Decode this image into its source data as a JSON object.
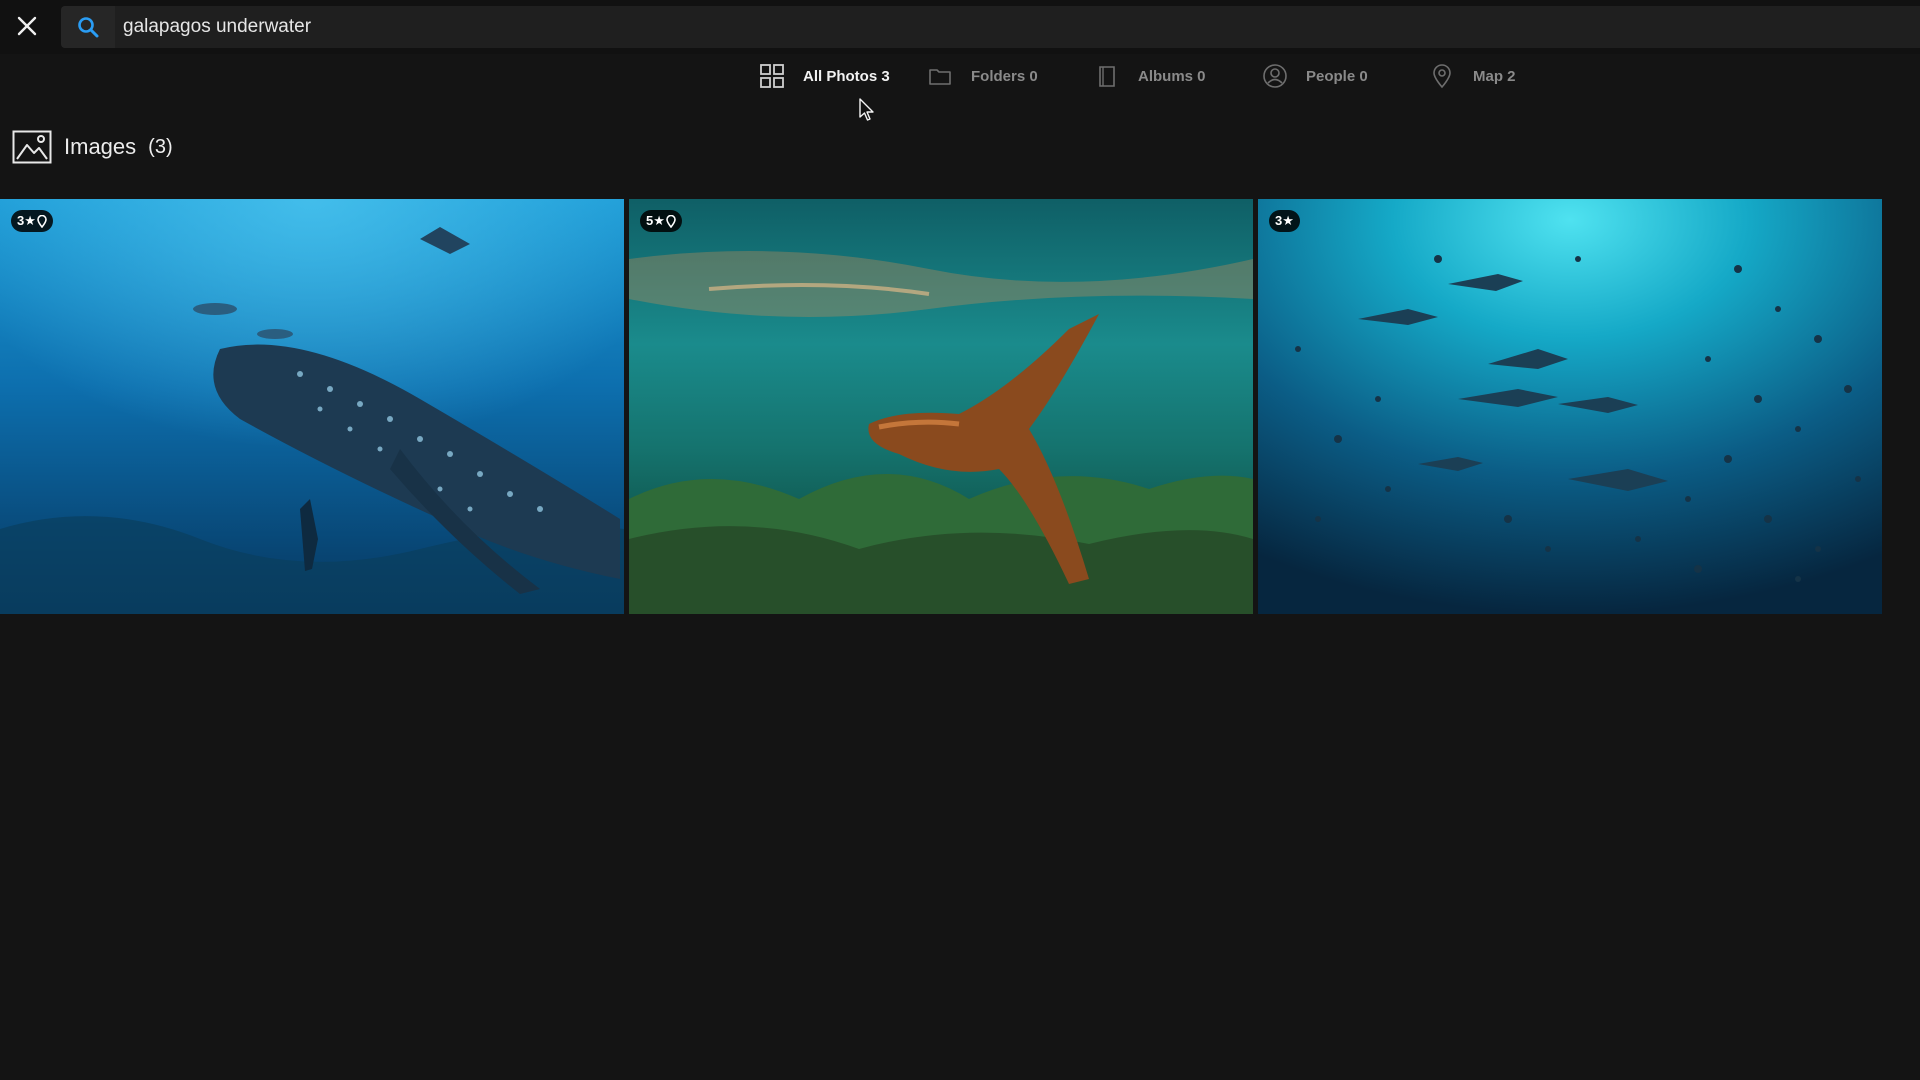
{
  "search": {
    "value": "galapagos underwater",
    "placeholder": "Search"
  },
  "tabs": [
    {
      "label": "All Photos 3",
      "icon": "grid-icon",
      "active": true
    },
    {
      "label": "Folders 0",
      "icon": "folder-icon",
      "active": false
    },
    {
      "label": "Albums 0",
      "icon": "album-icon",
      "active": false
    },
    {
      "label": "People 0",
      "icon": "person-icon",
      "active": false
    },
    {
      "label": "Map 2",
      "icon": "map-pin-icon",
      "active": false
    }
  ],
  "section": {
    "label": "Images",
    "count": "(3)",
    "icon": "image-icon"
  },
  "photos": [
    {
      "badge": "3★",
      "has_location": true,
      "subject": "whale shark with divers"
    },
    {
      "badge": "5★",
      "has_location": true,
      "subject": "sea lion swimming"
    },
    {
      "badge": "3★",
      "has_location": false,
      "subject": "hammerhead sharks school"
    }
  ],
  "colors": {
    "background": "#141414",
    "accent": "#2a9df4",
    "active_tab": "#f2f2f2",
    "inactive_tab": "#8a8a8a"
  }
}
